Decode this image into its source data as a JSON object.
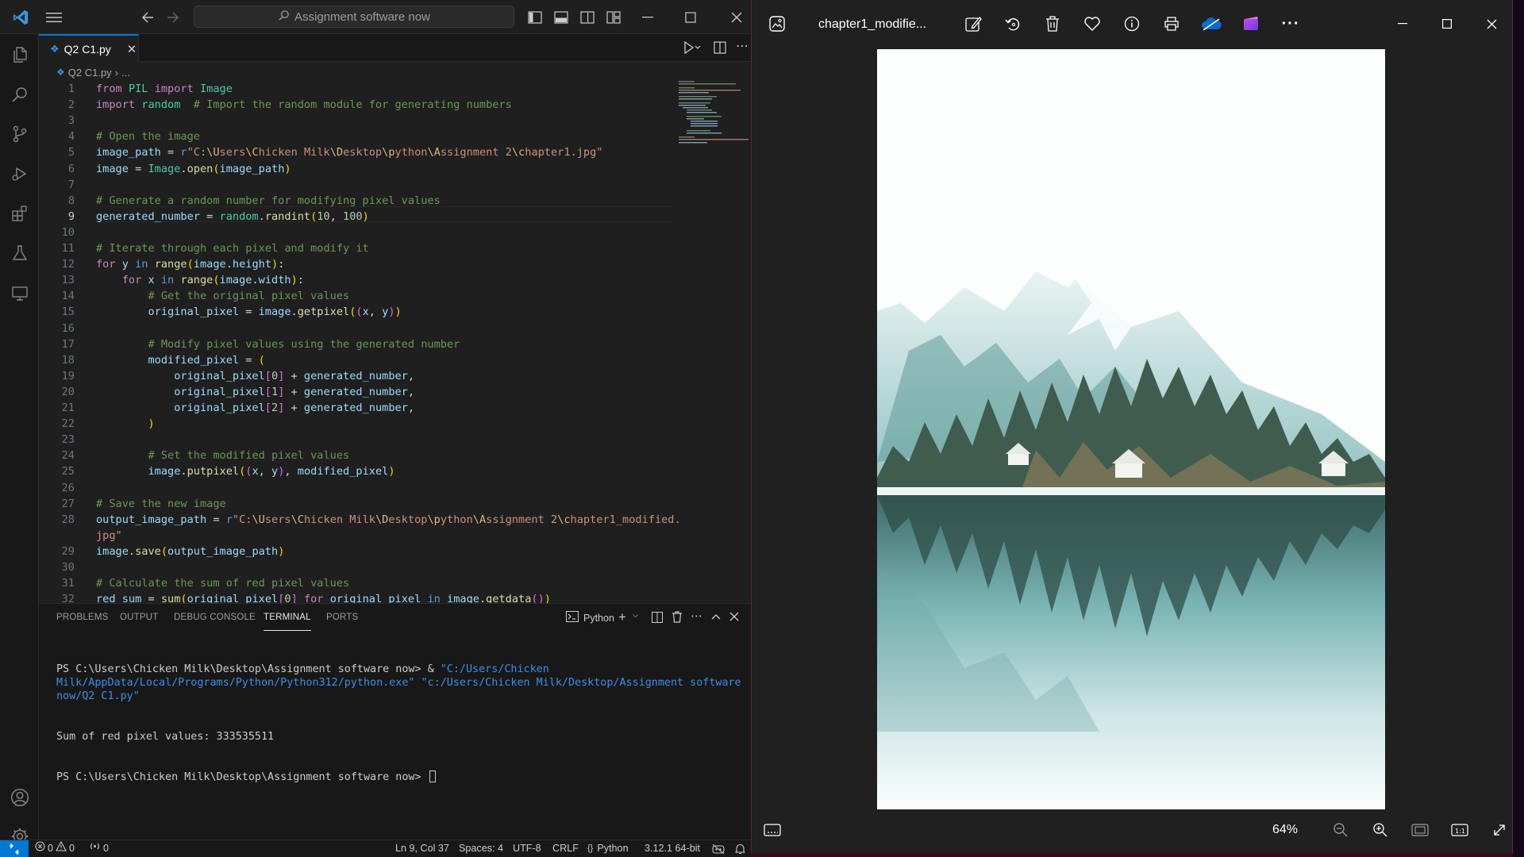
{
  "vscode": {
    "search_text": "Assignment software now",
    "tab_label": "Q2 C1.py",
    "breadcrumb_file": "Q2 C1.py",
    "breadcrumb_more": "...",
    "code_lines": [
      {
        "num": "1",
        "html": "<span class='k'>from</span> <span class='t'>PIL</span> <span class='k'>import</span> <span class='t'>Image</span>"
      },
      {
        "num": "2",
        "html": "<span class='k'>import</span> <span class='t'>random</span>  <span class='c'># Import the random module for generating numbers</span>"
      },
      {
        "num": "3",
        "html": ""
      },
      {
        "num": "4",
        "html": "<span class='c'># Open the image</span>"
      },
      {
        "num": "5",
        "html": "<span class='v'>image_path</span> <span class='w'>=</span> <span class='b'>r</span><span class='s'>\"C:</span><span class='e'>\\U</span><span class='s'>sers</span><span class='e'>\\C</span><span class='s'>hicken Milk</span><span class='e'>\\D</span><span class='s'>esktop</span><span class='e'>\\p</span><span class='s'>ython</span><span class='e'>\\A</span><span class='s'>ssignment 2</span><span class='e'>\\c</span><span class='s'>hapter1.jpg\"</span>"
      },
      {
        "num": "6",
        "html": "<span class='v'>image</span> <span class='w'>=</span> <span class='t'>Image</span><span class='w'>.</span><span class='f'>open</span><span class='p'>(</span><span class='v'>image_path</span><span class='p'>)</span>"
      },
      {
        "num": "7",
        "html": ""
      },
      {
        "num": "8",
        "html": "<span class='c'># Generate a random number for modifying pixel values</span>"
      },
      {
        "num": "9",
        "html": "<span class='v'>generated_number</span> <span class='w'>=</span> <span class='t'>random</span><span class='w'>.</span><span class='f'>randint</span><span class='p'>(</span><span class='n'>10</span><span class='w'>,</span> <span class='n'>100</span><span class='p'>)</span>",
        "current": true
      },
      {
        "num": "10",
        "html": ""
      },
      {
        "num": "11",
        "html": "<span class='c'># Iterate through each pixel and modify it</span>"
      },
      {
        "num": "12",
        "html": "<span class='k'>for</span> <span class='v'>y</span> <span class='b'>in</span> <span class='f'>range</span><span class='p'>(</span><span class='v'>image</span><span class='w'>.</span><span class='v'>height</span><span class='p'>)</span><span class='w'>:</span>"
      },
      {
        "num": "13",
        "html": "    <span class='k'>for</span> <span class='v'>x</span> <span class='b'>in</span> <span class='f'>range</span><span class='p'>(</span><span class='v'>image</span><span class='w'>.</span><span class='v'>width</span><span class='p'>)</span><span class='w'>:</span>"
      },
      {
        "num": "14",
        "html": "        <span class='c'># Get the original pixel values</span>"
      },
      {
        "num": "15",
        "html": "        <span class='v'>original_pixel</span> <span class='w'>=</span> <span class='v'>image</span><span class='w'>.</span><span class='f'>getpixel</span><span class='p'>(</span><span class='p2'>(</span><span class='v'>x</span><span class='w'>,</span> <span class='v'>y</span><span class='p2'>)</span><span class='p'>)</span>"
      },
      {
        "num": "16",
        "html": ""
      },
      {
        "num": "17",
        "html": "        <span class='c'># Modify pixel values using the generated number</span>"
      },
      {
        "num": "18",
        "html": "        <span class='v'>modified_pixel</span> <span class='w'>=</span> <span class='p'>(</span>"
      },
      {
        "num": "19",
        "html": "            <span class='v'>original_pixel</span><span class='p2'>[</span><span class='n'>0</span><span class='p2'>]</span> <span class='w'>+</span> <span class='v'>generated_number</span><span class='w'>,</span>"
      },
      {
        "num": "20",
        "html": "            <span class='v'>original_pixel</span><span class='p2'>[</span><span class='n'>1</span><span class='p2'>]</span> <span class='w'>+</span> <span class='v'>generated_number</span><span class='w'>,</span>"
      },
      {
        "num": "21",
        "html": "            <span class='v'>original_pixel</span><span class='p2'>[</span><span class='n'>2</span><span class='p2'>]</span> <span class='w'>+</span> <span class='v'>generated_number</span><span class='w'>,</span>"
      },
      {
        "num": "22",
        "html": "        <span class='p'>)</span>"
      },
      {
        "num": "23",
        "html": ""
      },
      {
        "num": "24",
        "html": "        <span class='c'># Set the modified pixel values</span>"
      },
      {
        "num": "25",
        "html": "        <span class='v'>image</span><span class='w'>.</span><span class='f'>putpixel</span><span class='p'>(</span><span class='p2'>(</span><span class='v'>x</span><span class='w'>,</span> <span class='v'>y</span><span class='p2'>)</span><span class='w'>,</span> <span class='v'>modified_pixel</span><span class='p'>)</span>"
      },
      {
        "num": "26",
        "html": ""
      },
      {
        "num": "27",
        "html": "<span class='c'># Save the new image</span>"
      },
      {
        "num": "28",
        "html": "<span class='v'>output_image_path</span> <span class='w'>=</span> <span class='b'>r</span><span class='s'>\"C:</span><span class='e'>\\U</span><span class='s'>sers</span><span class='e'>\\C</span><span class='s'>hicken Milk</span><span class='e'>\\D</span><span class='s'>esktop</span><span class='e'>\\p</span><span class='s'>ython</span><span class='e'>\\A</span><span class='s'>ssignment 2</span><span class='e'>\\c</span><span class='s'>hapter1_modified.</span>"
      },
      {
        "num": "",
        "html": "<span class='s'>jpg\"</span>"
      },
      {
        "num": "29",
        "html": "<span class='v'>image</span><span class='w'>.</span><span class='f'>save</span><span class='p'>(</span><span class='v'>output_image_path</span><span class='p'>)</span>"
      },
      {
        "num": "30",
        "html": ""
      },
      {
        "num": "31",
        "html": "<span class='c'># Calculate the sum of red pixel values</span>"
      },
      {
        "num": "32",
        "html": "<span class='v'>red_sum</span> <span class='w'>=</span> <span class='f'>sum</span><span class='p'>(</span><span class='v'>original_pixel</span><span class='p2'>[</span><span class='n'>0</span><span class='p2'>]</span> <span class='k'>for</span> <span class='v'>original_pixel</span> <span class='b'>in</span> <span class='v'>image</span><span class='w'>.</span><span class='f'>getdata</span><span class='p2'>()</span><span class='p'>)</span>"
      }
    ],
    "panel_tabs": [
      "PROBLEMS",
      "OUTPUT",
      "DEBUG CONSOLE",
      "TERMINAL",
      "PORTS"
    ],
    "terminal_shell": "Python",
    "terminal": {
      "line1_prompt": "PS C:\\Users\\Chicken Milk\\Desktop\\Assignment software now> & ",
      "line1_exe": "\"C:/Users/Chicken Milk/AppData/Local/Programs/Python/Python312/python.exe\"",
      "line1_script": " \"c:/Users/Chicken Milk/Desktop/Assignment software now/Q2 C1.py\"",
      "line2": "Sum of red pixel values: 333535511",
      "line3": "PS C:\\Users\\Chicken Milk\\Desktop\\Assignment software now> "
    },
    "status": {
      "errors": "0",
      "warnings": "0",
      "ports": "0",
      "cursor_pos": "Ln 9, Col 37",
      "spaces": "Spaces: 4",
      "encoding": "UTF-8",
      "eol": "CRLF",
      "language": "Python",
      "interpreter": "3.12.1 64-bit"
    }
  },
  "photos": {
    "filename": "chapter1_modifie...",
    "zoom": "64%"
  },
  "colors": {
    "accent": "#0078d4",
    "photos_bg": "#202020",
    "editor_bg": "#1f1f1f"
  }
}
